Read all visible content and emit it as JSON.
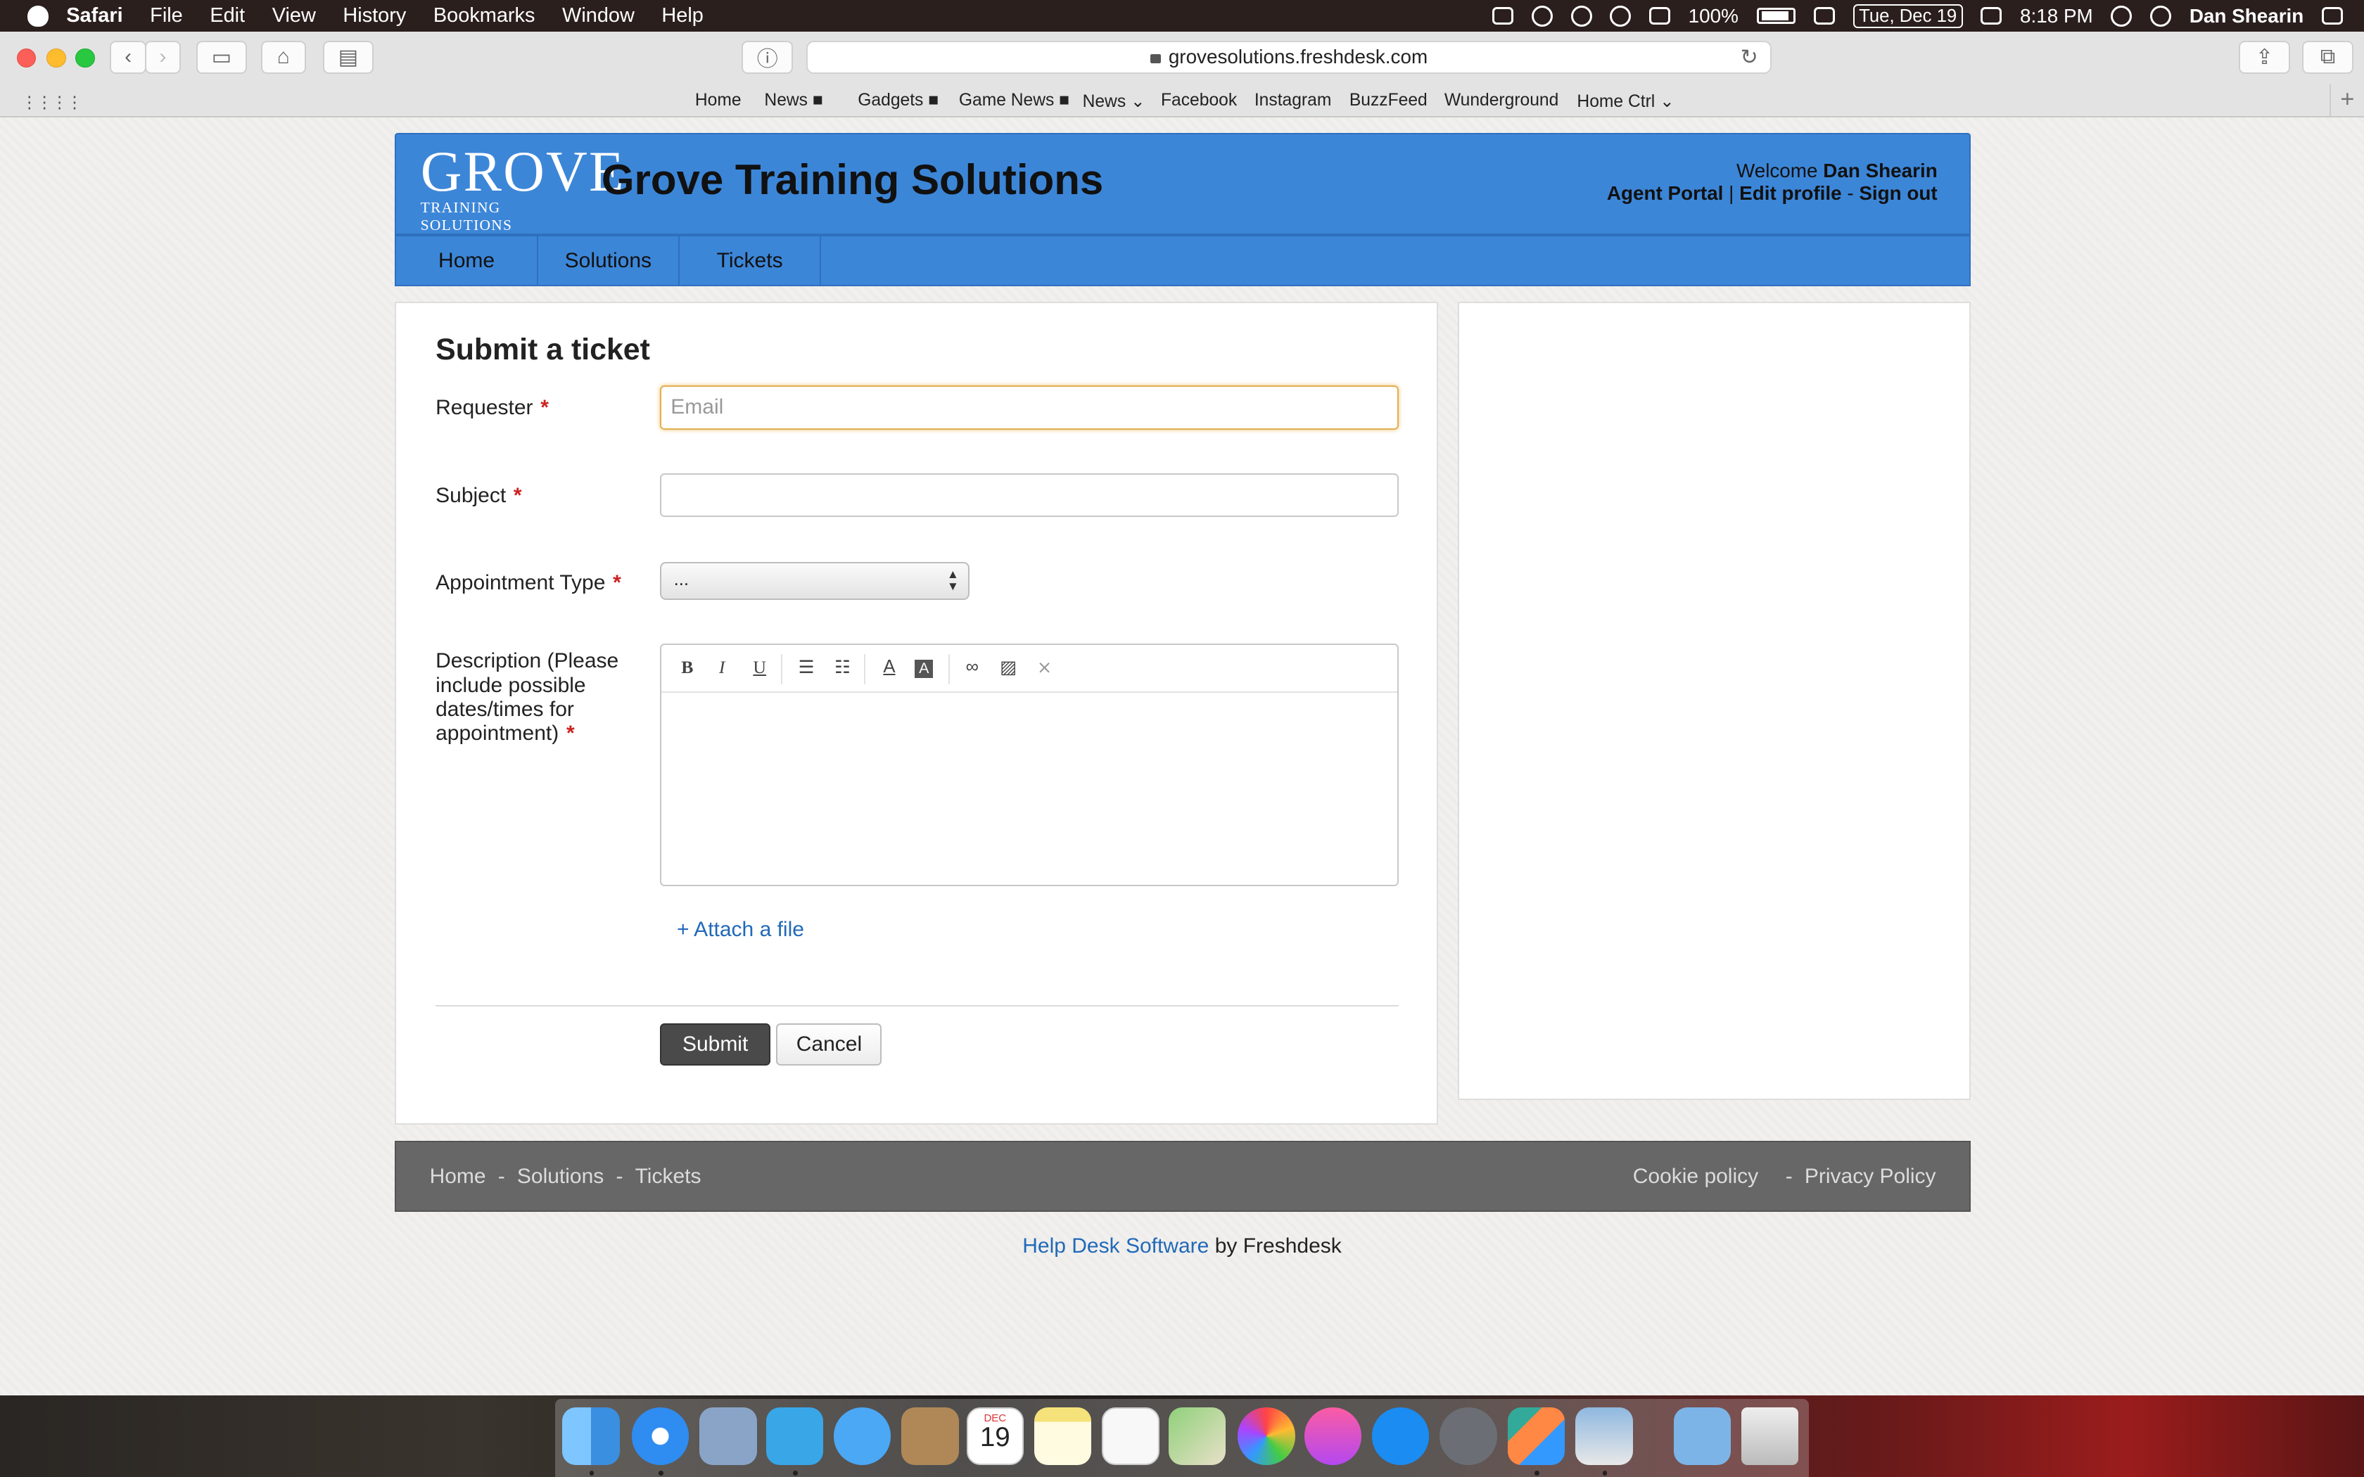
{
  "menubar": {
    "app_name": "Safari",
    "items": [
      "File",
      "Edit",
      "View",
      "History",
      "Bookmarks",
      "Window",
      "Help"
    ],
    "battery": "100%",
    "date": "Tue, Dec 19",
    "time": "8:18 PM",
    "user": "Dan Shearin"
  },
  "browser": {
    "address": "grovesolutions.freshdesk.com",
    "bookmarks": [
      "Home",
      "News ■",
      "Gadgets ■",
      "Game News ■",
      "News ⌄",
      "Facebook",
      "Instagram",
      "BuzzFeed",
      "Wunderground",
      "Home Ctrl ⌄"
    ]
  },
  "header": {
    "logo_big": "GROVE",
    "logo_small": "TRAINING SOLUTIONS",
    "site_title": "Grove Training Solutions",
    "welcome_prefix": "Welcome",
    "user_name": "Dan Shearin",
    "agent_portal": "Agent Portal",
    "separator_pipe": "|",
    "edit_profile": "Edit profile",
    "separator_dash": "-",
    "sign_out": "Sign out"
  },
  "nav": {
    "tabs": [
      "Home",
      "Solutions",
      "Tickets"
    ]
  },
  "form": {
    "title": "Submit a ticket",
    "requester_label": "Requester",
    "requester_placeholder": "Email",
    "subject_label": "Subject",
    "subject_value": "",
    "appointment_label": "Appointment Type",
    "appointment_value": "...",
    "description_label": "Description (Please include possible dates/times for appointment)",
    "required_mark": "*",
    "editor_tools": [
      "B",
      "I",
      "U",
      "bulleted-list",
      "numbered-list",
      "A",
      "A",
      "link",
      "image",
      "remove-format"
    ],
    "attach_label": "+ Attach a file",
    "submit_label": "Submit",
    "cancel_label": "Cancel"
  },
  "footer": {
    "left_links": [
      "Home",
      "Solutions",
      "Tickets"
    ],
    "right_links": [
      "Cookie policy",
      "Privacy Policy"
    ],
    "link_separator": "-",
    "powered_link": "Help Desk Software",
    "powered_suffix": "by Freshdesk"
  },
  "dock": {
    "apps": [
      "finder-icon",
      "safari-icon",
      "mail-icon",
      "tweetbot-icon",
      "messages-icon",
      "contacts-icon",
      "calendar-icon",
      "notes-icon",
      "reminders-icon",
      "maps-icon",
      "photos-icon",
      "itunes-icon",
      "app-store-icon",
      "system-preferences-icon",
      "screen-sharing-icon",
      "preview-icon",
      "downloads-folder-icon",
      "trash-icon"
    ],
    "calendar_month": "DEC",
    "calendar_day": "19"
  },
  "colors": {
    "header_blue": "#3c86d8",
    "link_blue": "#2169b8",
    "required_red": "#cc2222",
    "focus_outline": "#e0b052"
  }
}
